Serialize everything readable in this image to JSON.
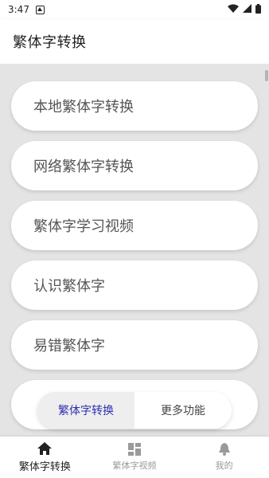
{
  "status_bar": {
    "time": "3:47",
    "icons": [
      "notification-icon",
      "wifi-icon",
      "signal-icon",
      "battery-icon"
    ]
  },
  "app_bar": {
    "title": "繁体字转换"
  },
  "menu": {
    "items": [
      {
        "label": "本地繁体字转换"
      },
      {
        "label": "网络繁体字转换"
      },
      {
        "label": "繁体字学习视频"
      },
      {
        "label": "认识繁体字"
      },
      {
        "label": "易错繁体字"
      }
    ]
  },
  "tab_switch": {
    "active_label": "繁体字转换",
    "other_label": "更多功能",
    "active_color": "#2f2fb0"
  },
  "bottom_nav": {
    "items": [
      {
        "label": "繁体字转换",
        "icon": "home-icon",
        "active": true
      },
      {
        "label": "繁体字视频",
        "icon": "grid-icon",
        "active": false
      },
      {
        "label": "我的",
        "icon": "bell-icon",
        "active": false
      }
    ]
  }
}
